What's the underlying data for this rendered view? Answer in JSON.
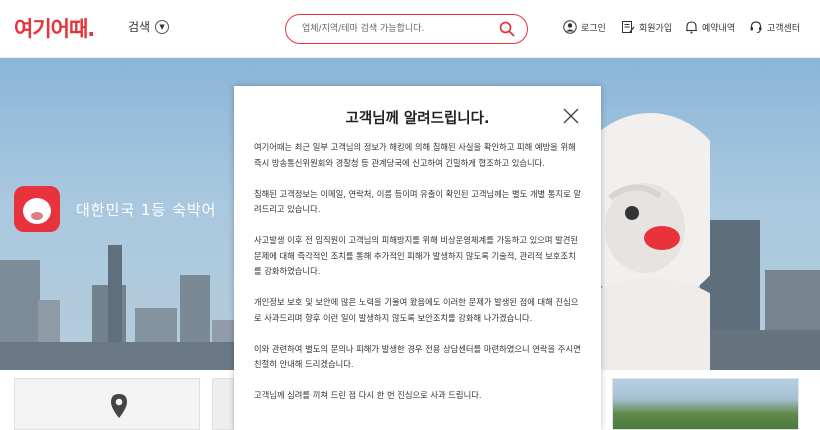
{
  "header": {
    "logo": "여기어때.",
    "search_toggle_label": "검색",
    "search_placeholder": "업체/지역/테마 검색 가능합니다.",
    "nav": {
      "login": "로그인",
      "signup": "회원가입",
      "reservations": "예약내역",
      "support": "고객센터"
    }
  },
  "hero": {
    "tagline": "대한민국 1등 숙박어"
  },
  "modal": {
    "title": "고객님께 알려드립니다.",
    "paragraphs": [
      "여기어때는 최근 일부 고객님의 정보가 해킹에 의해 침해된 사실을 확인하고 피해 예방을 위해 즉시 방송통신위원회와 경찰청 등 관계당국에 신고하여 긴밀하게 협조하고 있습니다.",
      "침해된 고객정보는 이메일, 연락처, 이름 등이며 유출이 확인된 고객님께는 별도 개별 통지로 알려드리고 있습니다.",
      "사고발생 이후 전 임직원이 고객님의 피해방지를 위해 비상운영체계를 가동하고 있으며 발견된 문제에 대해 즉각적인 조치를 통해 추가적인 피해가 발생하지 않도록 기술적, 관리적 보호조치를 강화하였습니다.",
      "개인정보 보호 및 보안에 많은 노력을 기울여 왔음에도 이러한 문제가 발생된 점에 대해 진심으로 사과드리며 향후 이런 일이 발생하지 않도록 보안조치를 강화해 나가겠습니다.",
      "이와 관련하여 별도의 문의나 피해가 발생한 경우 전용 상담센터를 마련하였으니 연락을 주시면 친절히 안내해 드리겠습니다.",
      "고객님께 심려를 끼쳐 드린 점 다시 한 번 진심으로 사과 드립니다."
    ]
  }
}
